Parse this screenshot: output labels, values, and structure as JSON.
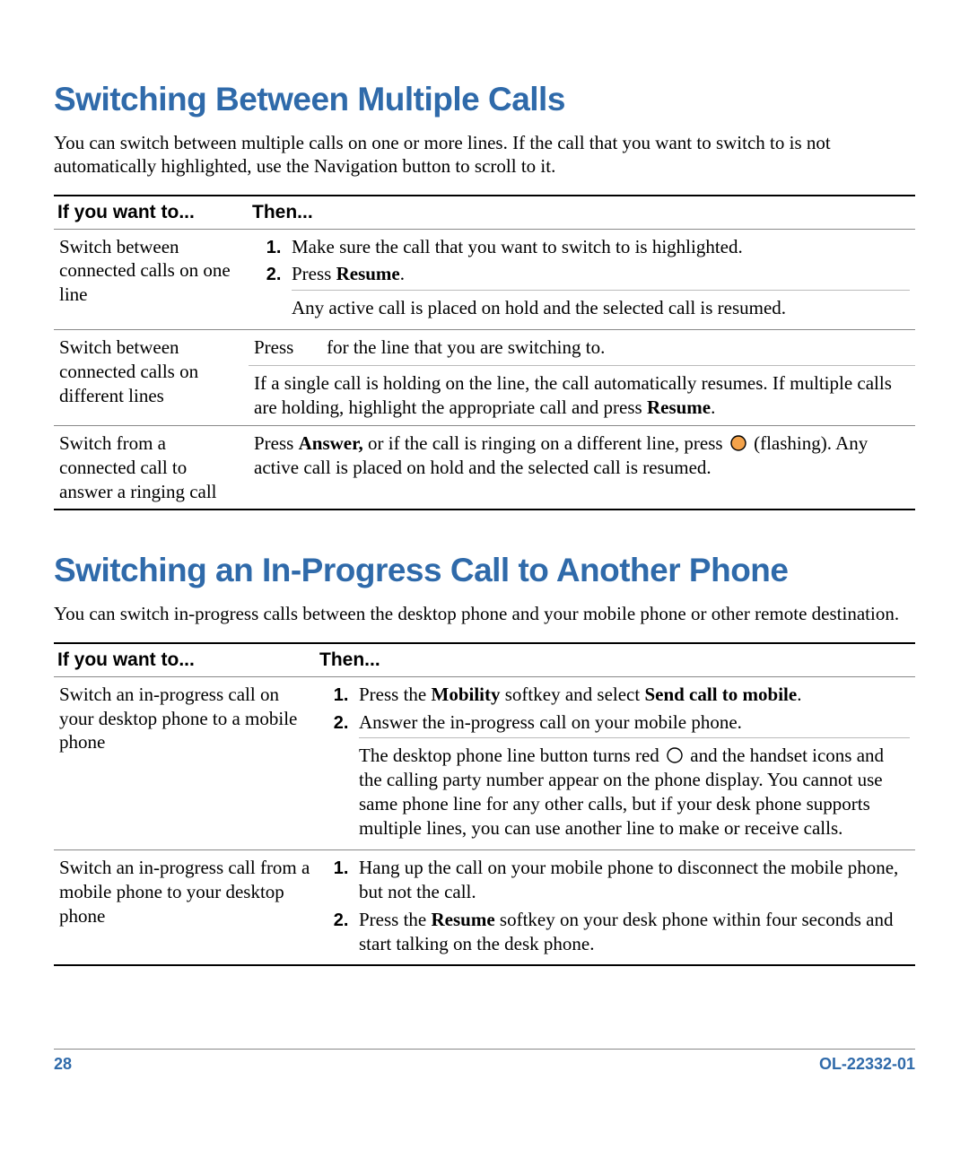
{
  "section1": {
    "title": "Switching Between Multiple Calls",
    "intro": "You can switch between multiple calls on one or more lines. If the call that you want to switch to is not automatically highlighted, use the Navigation button to scroll to it.",
    "col1": "If you want to...",
    "col2": "Then...",
    "r1_left": "Switch between connected calls on one line",
    "r1_s1": "Make sure the call that you want to switch to is highlighted.",
    "r1_s2a": "Press ",
    "r1_s2b": "Resume",
    "r1_s2c": ".",
    "r1_note": "Any active call is placed on hold and the selected call is resumed.",
    "r2_left": "Switch between connected calls on different lines",
    "r2_a1": "Press",
    "r2_a2": "for the line that you are switching to.",
    "r2_b1": "If a single call is holding on the line, the call automatically resumes. If multiple calls are holding, highlight the appropriate call and press ",
    "r2_b2": "Resume",
    "r2_b3": ".",
    "r3_left": "Switch from a connected call to answer a ringing call",
    "r3_a": "Press ",
    "r3_b": "Answer, ",
    "r3_c": "or if the call is ringing on a different line, press ",
    "r3_d": " (flashing). Any active call is placed on hold and the selected call is resumed."
  },
  "section2": {
    "title": "Switching an In-Progress Call to Another Phone",
    "intro": "You can switch in-progress calls between the desktop phone and your mobile phone or other remote destination.",
    "col1": "If you want to...",
    "col2": "Then...",
    "r1_left": "Switch an in-progress call on your desktop phone to a mobile phone",
    "r1_s1a": "Press the ",
    "r1_s1b": "Mobility ",
    "r1_s1c": "softkey and select ",
    "r1_s1d": "Send call to mobile",
    "r1_s1e": ".",
    "r1_s2": "Answer the in-progress call on your mobile phone.",
    "r1_note_a": "The desktop phone line button turns red ",
    "r1_note_b": " and the handset icons and the calling party number appear on the phone display. You cannot use same phone line for any other calls, but if your desk phone supports multiple lines, you can use another line to make or receive calls.",
    "r2_left": "Switch an in-progress call from a mobile phone to your desktop phone",
    "r2_s1": "Hang up the call on your mobile phone to disconnect the mobile phone, but not the call.",
    "r2_s2a": "Press the ",
    "r2_s2b": "Resume ",
    "r2_s2c": "softkey on your desk phone within four seconds and start talking on the desk phone."
  },
  "footer": {
    "page": "28",
    "docid": "OL-22332-01"
  }
}
